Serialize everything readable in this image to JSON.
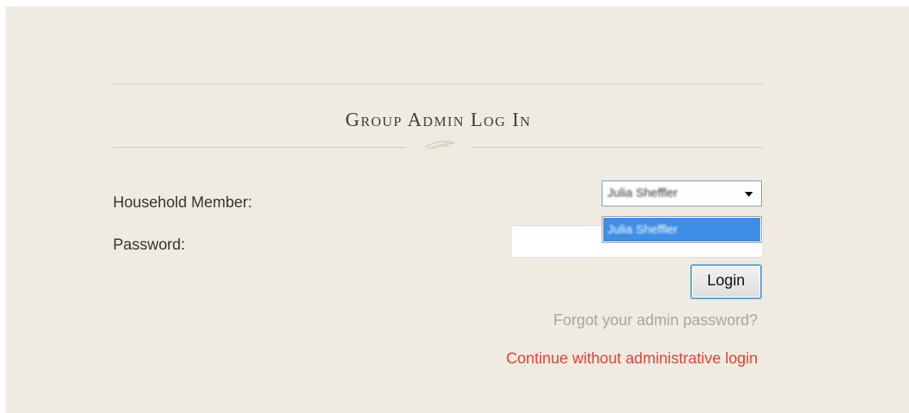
{
  "login": {
    "title": "Group Admin Log In",
    "member_label": "Household Member:",
    "password_label": "Password:",
    "member_select": {
      "selected": "Julia Sheffler",
      "options": [
        "Julia Sheffler"
      ]
    },
    "password_value": "",
    "login_button": "Login",
    "forgot_link": "Forgot your admin password?",
    "continue_link": "Continue without administrative login"
  },
  "colors": {
    "background": "#efebe0",
    "divider": "#d3cdb6",
    "link_muted": "#a6a6a6",
    "link_accent": "#e0413c",
    "selection": "#3d8ee5"
  },
  "icons": {
    "divider_ornament": "feather-icon"
  }
}
